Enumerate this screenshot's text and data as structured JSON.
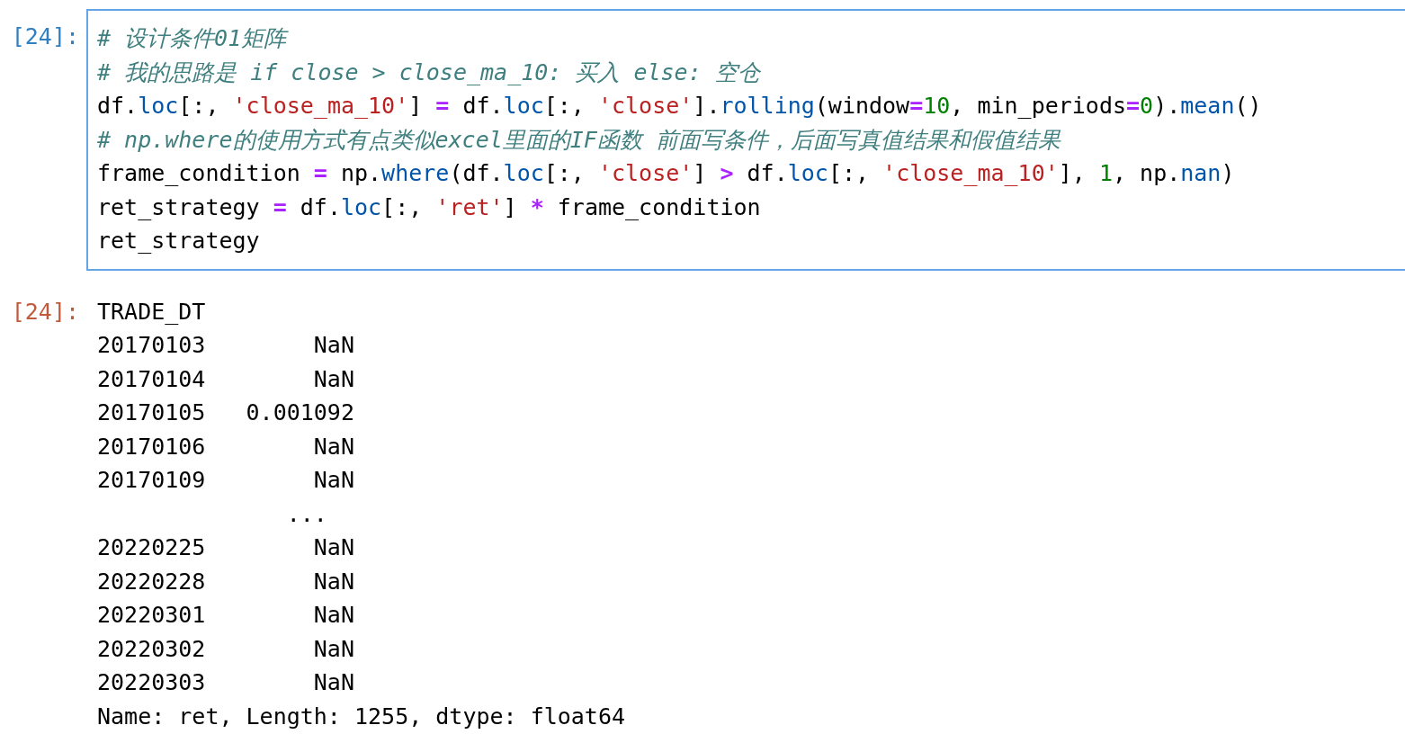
{
  "input_cell": {
    "prompt": "[24]:",
    "lines": [
      [
        {
          "kind": "comment",
          "text": "# 设计条件01矩阵"
        }
      ],
      [
        {
          "kind": "comment",
          "text": "# 我的思路是 if close > close_ma_10: 买入 else: 空仓"
        }
      ],
      [
        {
          "kind": "plain",
          "text": "df."
        },
        {
          "kind": "attr",
          "text": "loc"
        },
        {
          "kind": "plain",
          "text": "[:, "
        },
        {
          "kind": "string",
          "text": "'close_ma_10'"
        },
        {
          "kind": "plain",
          "text": "] "
        },
        {
          "kind": "operator",
          "text": "="
        },
        {
          "kind": "plain",
          "text": " df."
        },
        {
          "kind": "attr",
          "text": "loc"
        },
        {
          "kind": "plain",
          "text": "[:, "
        },
        {
          "kind": "string",
          "text": "'close'"
        },
        {
          "kind": "plain",
          "text": "]."
        },
        {
          "kind": "attr",
          "text": "rolling"
        },
        {
          "kind": "plain",
          "text": "(window"
        },
        {
          "kind": "operator",
          "text": "="
        },
        {
          "kind": "number",
          "text": "10"
        },
        {
          "kind": "plain",
          "text": ", min_periods"
        },
        {
          "kind": "operator",
          "text": "="
        },
        {
          "kind": "number",
          "text": "0"
        },
        {
          "kind": "plain",
          "text": ")."
        },
        {
          "kind": "attr",
          "text": "mean"
        },
        {
          "kind": "plain",
          "text": "()"
        }
      ],
      [
        {
          "kind": "comment",
          "text": "# np.where的使用方式有点类似excel里面的IF函数 前面写条件，后面写真值结果和假值结果"
        }
      ],
      [
        {
          "kind": "plain",
          "text": "frame_condition "
        },
        {
          "kind": "operator",
          "text": "="
        },
        {
          "kind": "plain",
          "text": " np."
        },
        {
          "kind": "attr",
          "text": "where"
        },
        {
          "kind": "plain",
          "text": "(df."
        },
        {
          "kind": "attr",
          "text": "loc"
        },
        {
          "kind": "plain",
          "text": "[:, "
        },
        {
          "kind": "string",
          "text": "'close'"
        },
        {
          "kind": "plain",
          "text": "] "
        },
        {
          "kind": "operator",
          "text": ">"
        },
        {
          "kind": "plain",
          "text": " df."
        },
        {
          "kind": "attr",
          "text": "loc"
        },
        {
          "kind": "plain",
          "text": "[:, "
        },
        {
          "kind": "string",
          "text": "'close_ma_10'"
        },
        {
          "kind": "plain",
          "text": "], "
        },
        {
          "kind": "number",
          "text": "1"
        },
        {
          "kind": "plain",
          "text": ", np."
        },
        {
          "kind": "attr",
          "text": "nan"
        },
        {
          "kind": "plain",
          "text": ")"
        }
      ],
      [
        {
          "kind": "plain",
          "text": "ret_strategy "
        },
        {
          "kind": "operator",
          "text": "="
        },
        {
          "kind": "plain",
          "text": " df."
        },
        {
          "kind": "attr",
          "text": "loc"
        },
        {
          "kind": "plain",
          "text": "[:, "
        },
        {
          "kind": "string",
          "text": "'ret'"
        },
        {
          "kind": "plain",
          "text": "] "
        },
        {
          "kind": "operator",
          "text": "*"
        },
        {
          "kind": "plain",
          "text": " frame_condition"
        }
      ],
      [
        {
          "kind": "plain",
          "text": "ret_strategy"
        }
      ]
    ]
  },
  "output_cell": {
    "prompt": "[24]:",
    "index_name": "TRADE_DT",
    "rows": [
      {
        "index": "20170103",
        "value": "NaN"
      },
      {
        "index": "20170104",
        "value": "NaN"
      },
      {
        "index": "20170105",
        "value": "0.001092"
      },
      {
        "index": "20170106",
        "value": "NaN"
      },
      {
        "index": "20170109",
        "value": "NaN"
      }
    ],
    "ellipsis": "...",
    "rows_end": [
      {
        "index": "20220225",
        "value": "NaN"
      },
      {
        "index": "20220228",
        "value": "NaN"
      },
      {
        "index": "20220301",
        "value": "NaN"
      },
      {
        "index": "20220302",
        "value": "NaN"
      },
      {
        "index": "20220303",
        "value": "NaN"
      }
    ],
    "footer": "Name: ret, Length: 1255, dtype: float64"
  }
}
